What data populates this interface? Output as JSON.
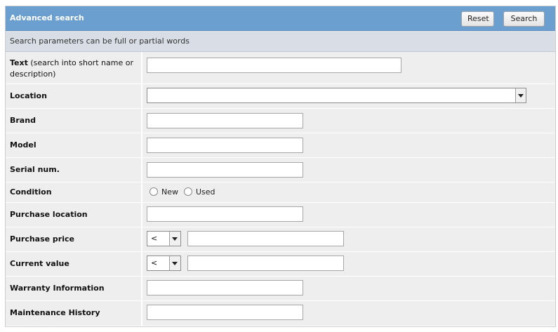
{
  "header": {
    "title": "Advanced search",
    "reset_label": "Reset",
    "search_label": "Search"
  },
  "notice": "Search parameters can be full or partial words",
  "fields": {
    "text_label": "Text",
    "text_hint": "(search into short name or description)",
    "location_label": "Location",
    "brand_label": "Brand",
    "model_label": "Model",
    "serial_label": "Serial num.",
    "condition_label": "Condition",
    "condition_new": "New",
    "condition_used": "Used",
    "purchase_location_label": "Purchase location",
    "purchase_price_label": "Purchase price",
    "purchase_price_op": "<",
    "current_value_label": "Current value",
    "current_value_op": "<",
    "warranty_label": "Warranty Information",
    "maintenance_label": "Maintenance History"
  },
  "colors": {
    "header_bg": "#6b9fd0",
    "notice_bg": "#d9dde6",
    "row_bg": "#eeeeee"
  }
}
